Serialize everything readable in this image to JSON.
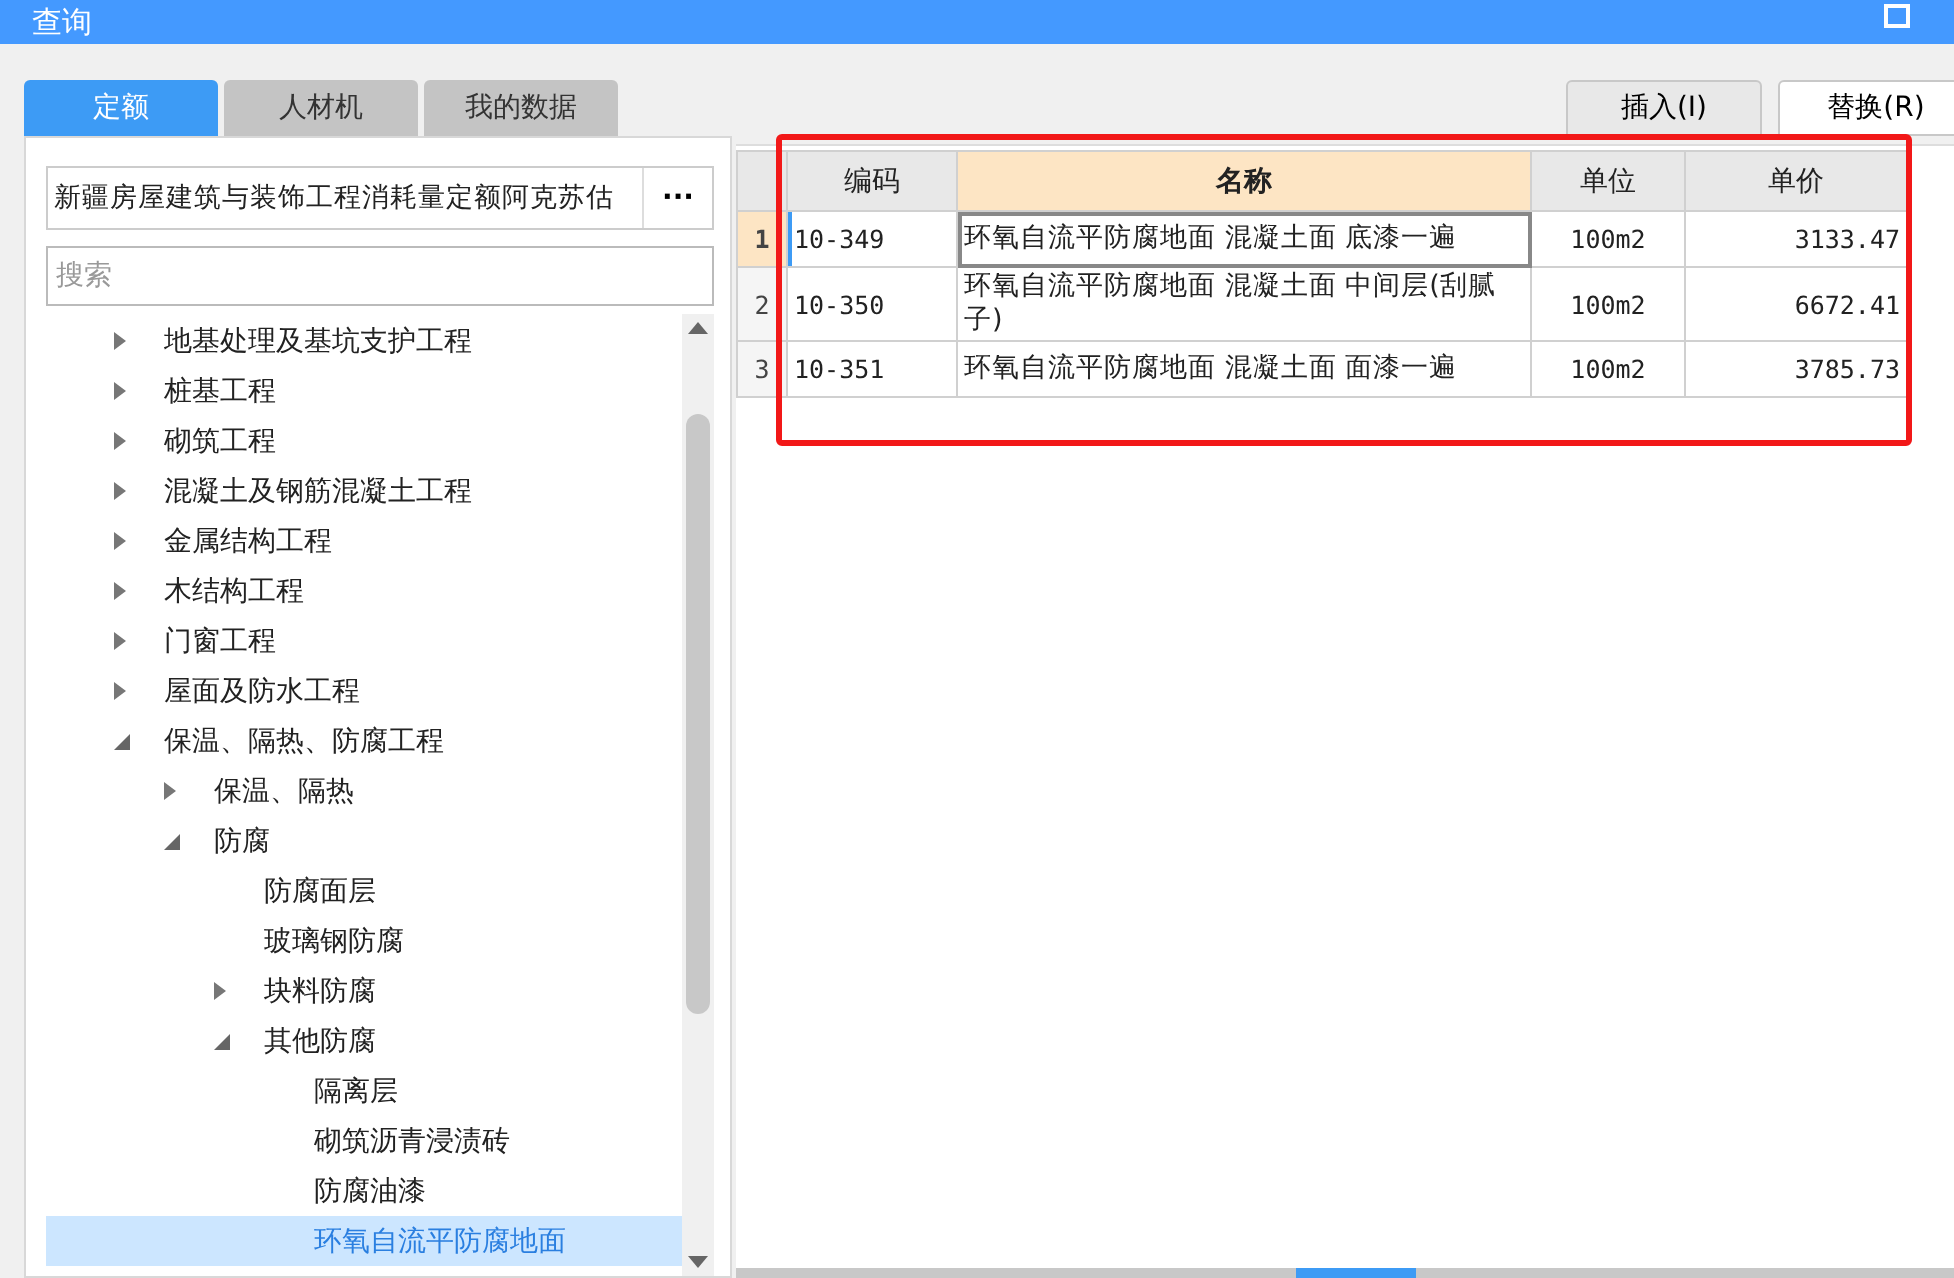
{
  "window": {
    "title": "查询"
  },
  "tabs": [
    {
      "label": "定额",
      "selected": true
    },
    {
      "label": "人材机",
      "selected": false
    },
    {
      "label": "我的数据",
      "selected": false
    }
  ],
  "library": {
    "value": "新疆房屋建筑与装饰工程消耗量定额阿克苏估",
    "button": "···"
  },
  "search": {
    "placeholder": "搜索"
  },
  "tree": [
    {
      "label": "地基处理及基坑支护工程",
      "kind": "folder",
      "expanded": false,
      "selected": false
    },
    {
      "label": "桩基工程",
      "kind": "folder",
      "expanded": false,
      "selected": false
    },
    {
      "label": "砌筑工程",
      "kind": "folder",
      "expanded": false,
      "selected": false
    },
    {
      "label": "混凝土及钢筋混凝土工程",
      "kind": "folder",
      "expanded": false,
      "selected": false
    },
    {
      "label": "金属结构工程",
      "kind": "folder",
      "expanded": false,
      "selected": false
    },
    {
      "label": "木结构工程",
      "kind": "folder",
      "expanded": false,
      "selected": false
    },
    {
      "label": "门窗工程",
      "kind": "folder",
      "expanded": false,
      "selected": false
    },
    {
      "label": "屋面及防水工程",
      "kind": "folder",
      "expanded": false,
      "selected": false
    },
    {
      "label": "保温、隔热、防腐工程",
      "kind": "folder",
      "expanded": true,
      "selected": false,
      "children": [
        {
          "label": "保温、隔热",
          "kind": "folder",
          "expanded": false,
          "selected": false
        },
        {
          "label": "防腐",
          "kind": "folder",
          "expanded": true,
          "selected": false,
          "children": [
            {
              "label": "防腐面层",
              "kind": "leaf",
              "selected": false
            },
            {
              "label": "玻璃钢防腐",
              "kind": "leaf",
              "selected": false
            },
            {
              "label": "块料防腐",
              "kind": "folder",
              "expanded": false,
              "selected": false
            },
            {
              "label": "其他防腐",
              "kind": "folder",
              "expanded": true,
              "selected": false,
              "children": [
                {
                  "label": "隔离层",
                  "kind": "leaf",
                  "selected": false
                },
                {
                  "label": "砌筑沥青浸渍砖",
                  "kind": "leaf",
                  "selected": false
                },
                {
                  "label": "防腐油漆",
                  "kind": "leaf",
                  "selected": false
                },
                {
                  "label": "环氧自流平防腐地面",
                  "kind": "leaf",
                  "selected": true
                }
              ]
            }
          ]
        }
      ]
    }
  ],
  "actions": [
    {
      "label": "插入(I)",
      "selected": false
    },
    {
      "label": "替换(R)",
      "selected": true
    }
  ],
  "table": {
    "columns": [
      {
        "label": "编码",
        "selected": false
      },
      {
        "label": "名称",
        "selected": true
      },
      {
        "label": "单位",
        "selected": false
      },
      {
        "label": "单价",
        "selected": false
      }
    ],
    "rows": [
      {
        "index": "1",
        "code": "10-349",
        "name": "环氧自流平防腐地面 混凝土面 底漆一遍",
        "unit": "100m2",
        "price": "3133.47",
        "selected": true
      },
      {
        "index": "2",
        "code": "10-350",
        "name": "环氧自流平防腐地面 混凝土面 中间层(刮腻子)",
        "unit": "100m2",
        "price": "6672.41",
        "selected": false
      },
      {
        "index": "3",
        "code": "10-351",
        "name": "环氧自流平防腐地面 混凝土面 面漆一遍",
        "unit": "100m2",
        "price": "3785.73",
        "selected": false
      }
    ]
  }
}
